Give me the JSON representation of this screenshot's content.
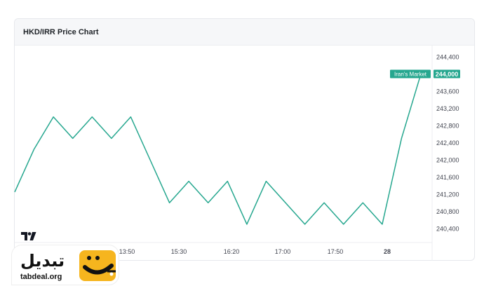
{
  "card": {
    "title": "HKD/IRR Price Chart"
  },
  "brand": {
    "name": "تبدیل",
    "url": "tabdeal.org"
  },
  "chart_data": {
    "type": "line",
    "title": "HKD/IRR Price Chart",
    "ylim": [
      240000,
      244600
    ],
    "y_ticks": [
      244400,
      244000,
      243600,
      243200,
      242800,
      242400,
      242000,
      241600,
      241200,
      240800,
      240400
    ],
    "x_ticks": [
      "13:50",
      "15:30",
      "16:20",
      "17:00",
      "17:50",
      "28"
    ],
    "grid": false,
    "series": [
      {
        "name": "Iran's Market",
        "color": "#26a78f",
        "last_value": "244,000",
        "values": [
          241250,
          242250,
          243000,
          242500,
          243000,
          242500,
          243000,
          242000,
          241000,
          241500,
          241000,
          241500,
          240500,
          241500,
          241000,
          240500,
          241000,
          240500,
          241000,
          240500,
          242500,
          244000
        ]
      }
    ]
  }
}
